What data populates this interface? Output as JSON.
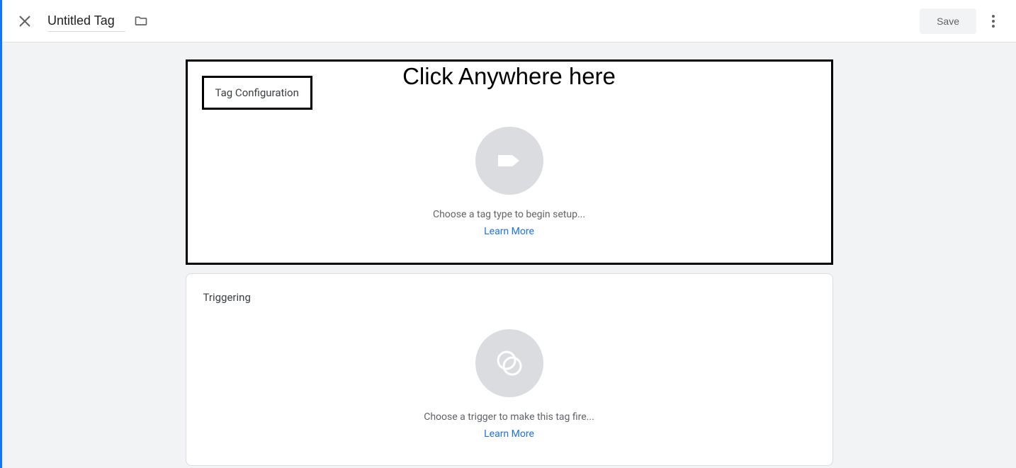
{
  "header": {
    "title": "Untitled Tag",
    "save_label": "Save"
  },
  "annotation": "Click Anywhere here",
  "tag_configuration": {
    "title": "Tag Configuration",
    "hint": "Choose a tag type to begin setup...",
    "learn_more": "Learn More"
  },
  "triggering": {
    "title": "Triggering",
    "hint": "Choose a trigger to make this tag fire...",
    "learn_more": "Learn More"
  }
}
